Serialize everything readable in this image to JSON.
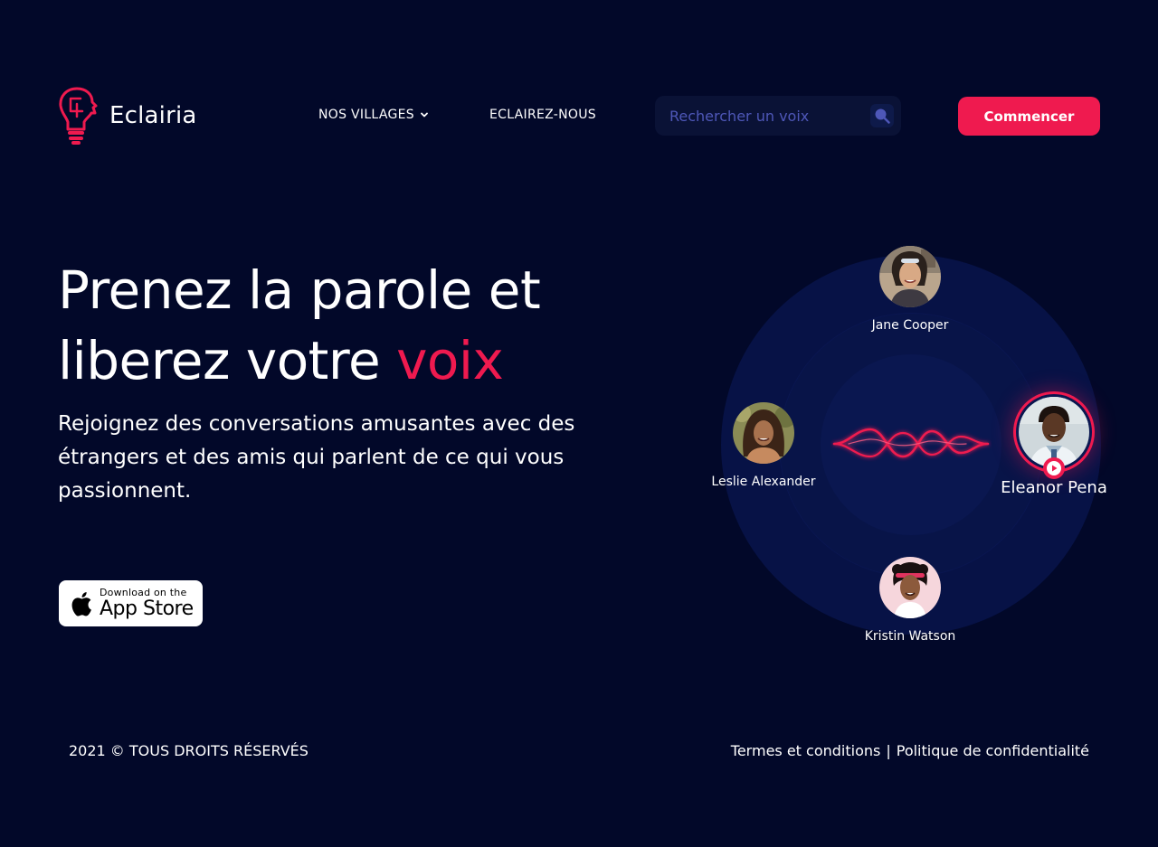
{
  "brand": {
    "name": "Eclairia",
    "accent_color": "#ef1a4f",
    "background_color": "#020829"
  },
  "nav": {
    "items": [
      {
        "label": "NOS VILLAGES",
        "icon": "chevron-down-icon"
      },
      {
        "label": "ECLAIREZ-NOUS"
      }
    ]
  },
  "search": {
    "placeholder": "Rechercher un voix",
    "value": "",
    "icon": "search-icon"
  },
  "header": {
    "cta_label": "Commencer"
  },
  "hero": {
    "title_part1": "Prenez la parole et liberez votre",
    "title_accent": "voix",
    "subtitle": "Rejoignez des conversations amusantes avec des étrangers et des amis qui parlent de ce qui vous passionnent."
  },
  "app_store": {
    "small_label": "Download on the",
    "big_label": "App Store",
    "icon": "apple-logo-icon"
  },
  "speakers": [
    {
      "name": "Jane Cooper"
    },
    {
      "name": "Leslie Alexander"
    },
    {
      "name": "Eleanor Pena",
      "active": true
    },
    {
      "name": "Kristin Watson"
    }
  ],
  "footer": {
    "copyright": "2021 © TOUS DROITS RÉSERVÉS",
    "links": [
      "Termes et conditions",
      "Politique de confidentialité"
    ],
    "separator": "|"
  }
}
